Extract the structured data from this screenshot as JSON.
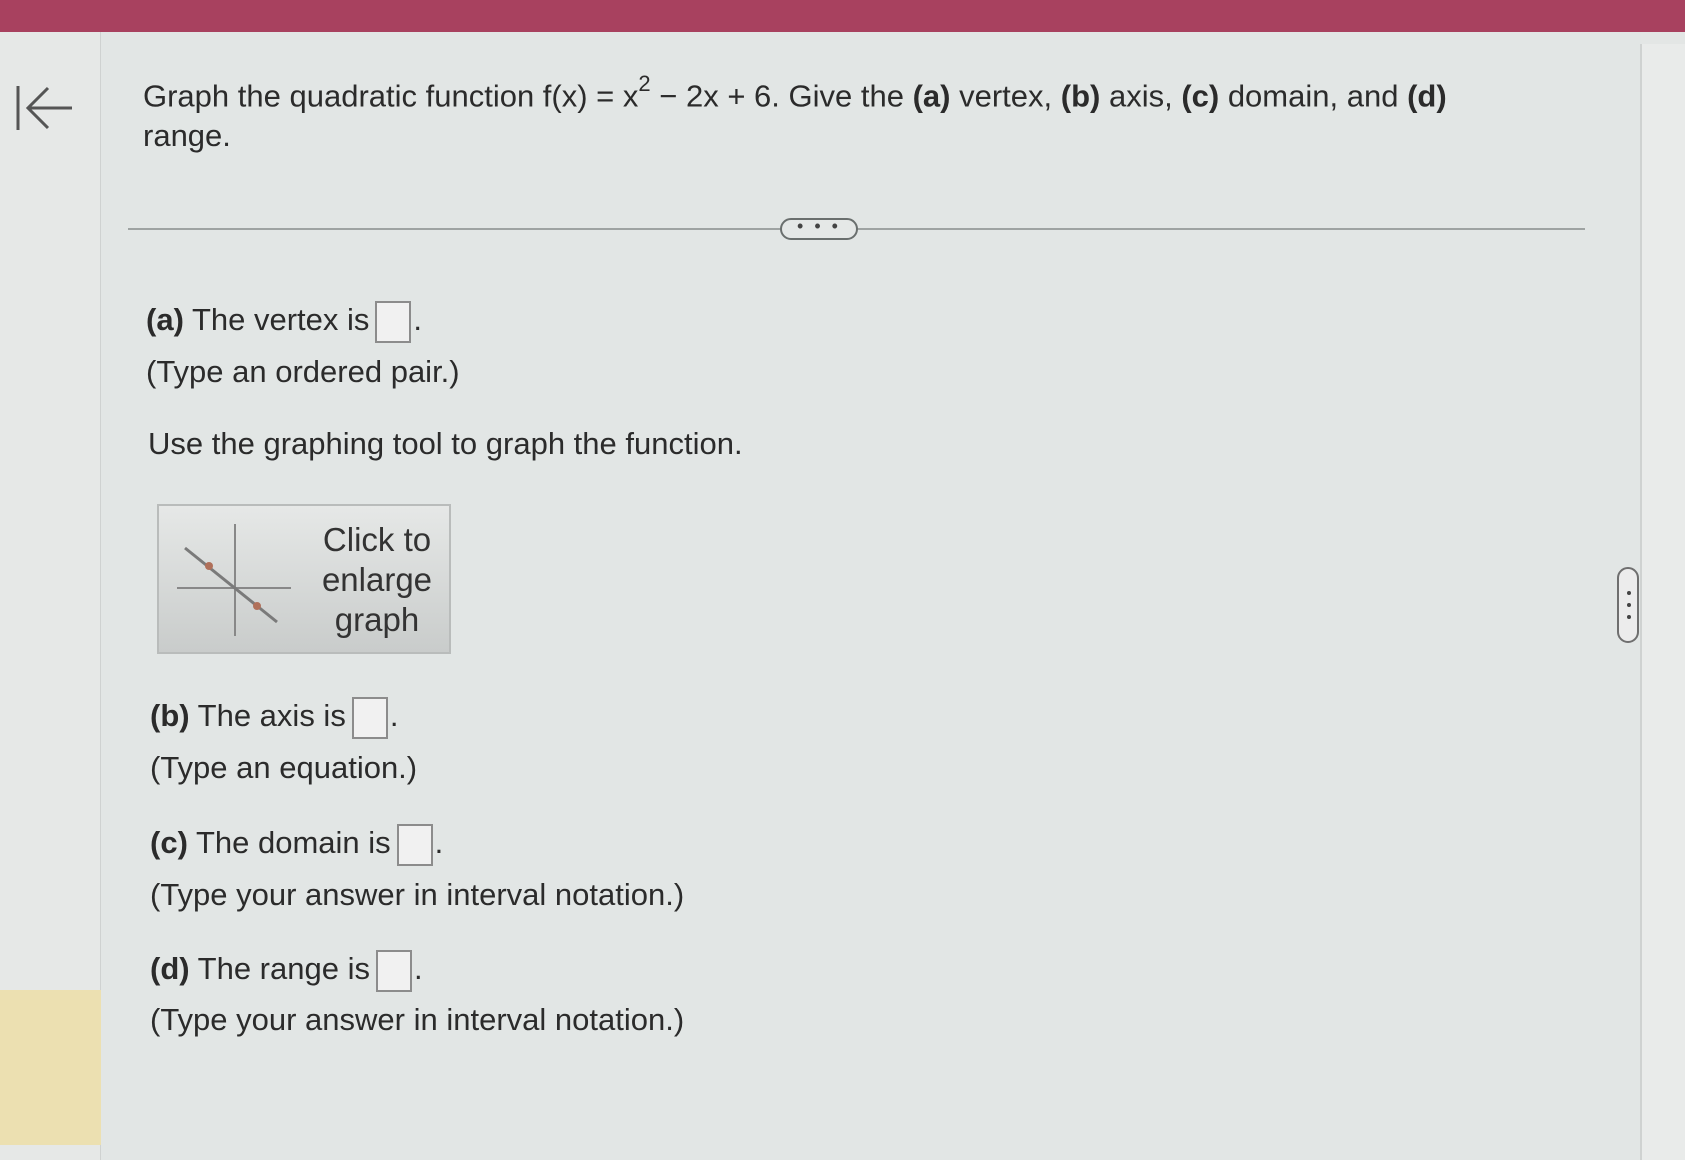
{
  "question": {
    "prefix": "Graph the quadratic function f(x) = x",
    "exponent": "2",
    "mid": " − 2x + 6. Give the ",
    "a_tag": "(a)",
    "a_word": " vertex, ",
    "b_tag": "(b)",
    "b_word": " axis, ",
    "c_tag": "(c)",
    "c_word": " domain, and ",
    "d_tag": "(d)",
    "d_word": " range."
  },
  "toggle": {
    "label": "• • •"
  },
  "part_a": {
    "tag": "(a)",
    "text": "The vertex is",
    "period": ".",
    "hint": "(Type an ordered pair.)"
  },
  "instruction": "Use the graphing tool to graph the function.",
  "graph_button": {
    "line1": "Click to",
    "line2": "enlarge",
    "line3": "graph"
  },
  "part_b": {
    "tag": "(b)",
    "text": "The axis is",
    "period": ".",
    "hint": "(Type an equation.)"
  },
  "part_c": {
    "tag": "(c)",
    "text": "The domain is",
    "period": ".",
    "hint": "(Type your answer in interval notation.)"
  },
  "part_d": {
    "tag": "(d)",
    "text": "The range is",
    "period": ".",
    "hint": "(Type your answer in interval notation.)"
  },
  "icons": {
    "back": "first-page-arrow-icon",
    "graph": "graph-thumbnail-icon",
    "scroll": "scroll-handle-icon"
  },
  "colors": {
    "top_bar": "#a8415f",
    "background": "#e2e6e5",
    "highlight": "#ece0b1"
  }
}
